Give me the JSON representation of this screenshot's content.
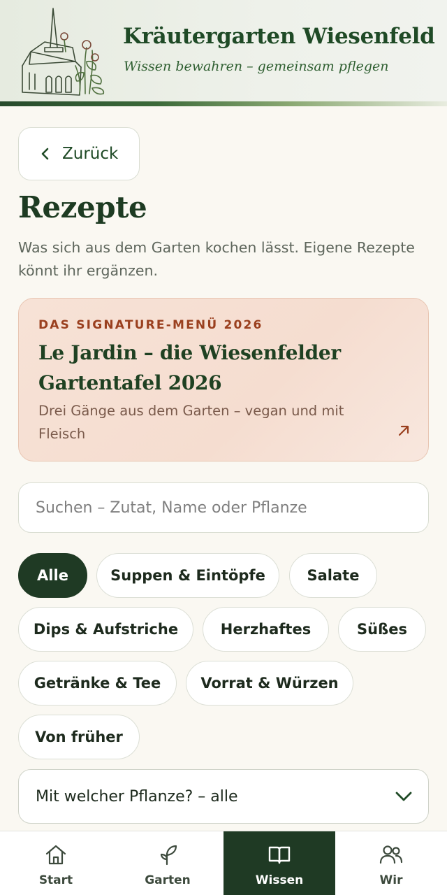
{
  "header": {
    "title": "Kräutergarten Wiesenfeld",
    "tagline": "Wissen bewahren – gemeinsam pflegen",
    "logo_icon": "church-with-herbs-sketch"
  },
  "back_button": {
    "label": "Zurück",
    "icon": "chevron-left-icon"
  },
  "page": {
    "title": "Rezepte",
    "intro": "Was sich aus dem Garten kochen lässt. Eigene Rezepte könnt ihr ergänzen."
  },
  "feature": {
    "eyebrow": "DAS SIGNATURE-MENÜ 2026",
    "title": "Le Jardin – die Wiesenfelder Gartentafel 2026",
    "subtitle": "Drei Gänge aus dem Garten – vegan und mit Fleisch",
    "icon": "arrow-up-right-icon"
  },
  "search": {
    "placeholder": "Suchen – Zutat, Name oder Pflanze",
    "value": ""
  },
  "filters": [
    {
      "label": "Alle",
      "active": true
    },
    {
      "label": "Suppen & Eintöpfe",
      "active": false
    },
    {
      "label": "Salate",
      "active": false
    },
    {
      "label": "Dips & Aufstriche",
      "active": false
    },
    {
      "label": "Herzhaftes",
      "active": false
    },
    {
      "label": "Süßes",
      "active": false
    },
    {
      "label": "Getränke & Tee",
      "active": false
    },
    {
      "label": "Vorrat & Würzen",
      "active": false
    },
    {
      "label": "Von früher",
      "active": false
    }
  ],
  "plant_select": {
    "value": "Mit welcher Pflanze? – alle",
    "icon": "chevron-down-icon"
  },
  "nav": [
    {
      "label": "Start",
      "icon": "home-icon",
      "active": false
    },
    {
      "label": "Garten",
      "icon": "sprout-icon",
      "active": false
    },
    {
      "label": "Wissen",
      "icon": "book-icon",
      "active": true
    },
    {
      "label": "Wir",
      "icon": "users-icon",
      "active": false
    }
  ],
  "colors": {
    "primary": "#1f3a24",
    "background": "#faf8f2",
    "accent": "#9a3f1e",
    "card": "#f6dfd2"
  }
}
